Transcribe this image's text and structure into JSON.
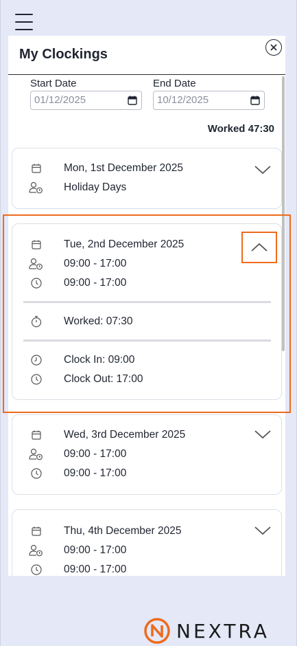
{
  "header": {
    "title": "My Clockings"
  },
  "filters": {
    "start_label": "Start Date",
    "start_value": "01/12/2025",
    "end_label": "End Date",
    "end_value": "10/12/2025"
  },
  "summary": {
    "worked_total": "Worked 47:30"
  },
  "days": [
    {
      "date": "Mon, 1st December 2025",
      "shift": "Holiday Days"
    },
    {
      "date": "Tue, 2nd December 2025",
      "shift": "09:00 - 17:00",
      "actual": "09:00 - 17:00",
      "worked": "Worked: 07:30",
      "clock_in": "Clock In: 09:00",
      "clock_out": "Clock Out: 17:00"
    },
    {
      "date": "Wed, 3rd December 2025",
      "shift": "09:00 - 17:00",
      "actual": "09:00 - 17:00"
    },
    {
      "date": "Thu, 4th December 2025",
      "shift": "09:00 - 17:00",
      "actual": "09:00 - 17:00"
    }
  ],
  "brand": {
    "name": "NEXTRA"
  },
  "colors": {
    "accent": "#ee6a1c",
    "background": "#e4e8f7"
  }
}
